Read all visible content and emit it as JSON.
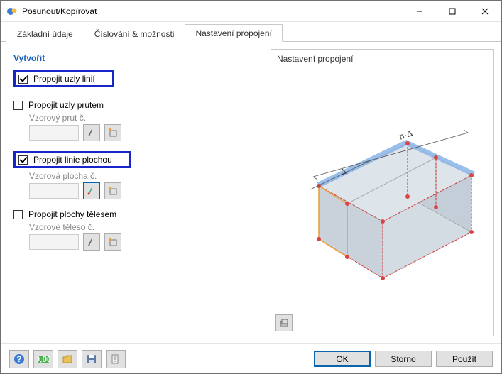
{
  "window": {
    "title": "Posunout/Kopírovat"
  },
  "tabs": {
    "basic": "Základní údaje",
    "numbering": "Číslování & možnosti",
    "connection": "Nastavení propojení"
  },
  "left": {
    "groupTitle": "Vytvořit",
    "opt1": {
      "label": "Propojit uzly linií",
      "checked": true,
      "highlighted": true
    },
    "opt2": {
      "label": "Propojit uzly prutem",
      "checked": false,
      "sublabel": "Vzorový prut č."
    },
    "opt3": {
      "label": "Propojit linie plochou",
      "checked": true,
      "highlighted": true,
      "sublabel": "Vzorová plocha č."
    },
    "opt4": {
      "label": "Propojit plochy tělesem",
      "checked": false,
      "sublabel": "Vzorové těleso č."
    }
  },
  "right": {
    "title": "Nastavení propojení",
    "dimLabel1": "n·Δ",
    "dimLabel2": "Δ"
  },
  "footer": {
    "ok": "OK",
    "cancel": "Storno",
    "apply": "Použít"
  },
  "iconNames": {
    "pick": "pick-icon",
    "new": "new-icon",
    "help": "help-icon",
    "units": "units-icon",
    "load": "load-icon",
    "save": "save-icon",
    "defaults": "defaults-icon",
    "viewmode": "viewmode-icon"
  }
}
